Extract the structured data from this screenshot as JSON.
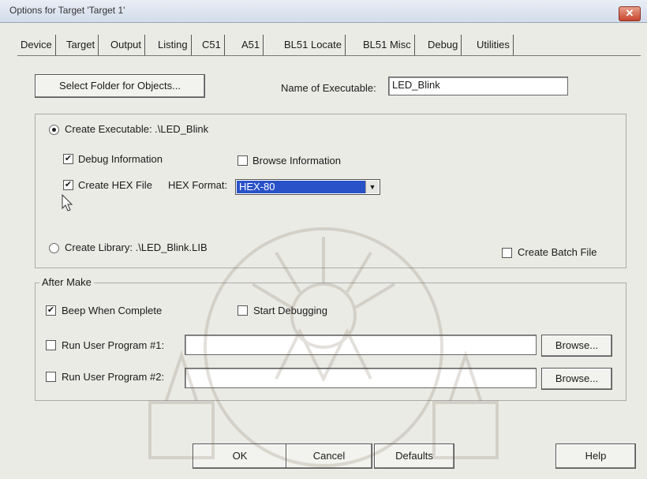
{
  "window": {
    "title": "Options for Target 'Target 1'",
    "close_symbol": "✕"
  },
  "tabs": [
    {
      "label": "Device",
      "active": false
    },
    {
      "label": "Target",
      "active": false
    },
    {
      "label": "Output",
      "active": true
    },
    {
      "label": "Listing",
      "active": false
    },
    {
      "label": "C51",
      "active": false
    },
    {
      "label": "A51",
      "active": false
    },
    {
      "label": "BL51 Locate",
      "active": false
    },
    {
      "label": "BL51 Misc",
      "active": false
    },
    {
      "label": "Debug",
      "active": false
    },
    {
      "label": "Utilities",
      "active": false
    }
  ],
  "output": {
    "select_folder_label": "Select Folder for Objects...",
    "name_exec_label": "Name of Executable:",
    "name_exec_value": "LED_Blink",
    "create_exec_label": "Create Executable: .\\LED_Blink",
    "create_exec_selected": true,
    "debug_info_label": "Debug Information",
    "debug_info_checked": true,
    "browse_info_label": "Browse Information",
    "browse_info_checked": false,
    "create_hex_label": "Create HEX File",
    "create_hex_checked": true,
    "hex_format_label": "HEX Format:",
    "hex_format_value": "HEX-80",
    "create_lib_label": "Create Library: .\\LED_Blink.LIB",
    "create_lib_selected": false,
    "create_batch_label": "Create Batch File",
    "create_batch_checked": false
  },
  "after_make": {
    "legend": "After Make",
    "beep_label": "Beep When Complete",
    "beep_checked": true,
    "start_debug_label": "Start Debugging",
    "start_debug_checked": false,
    "run1_label": "Run User Program #1:",
    "run1_checked": false,
    "run1_value": "",
    "run2_label": "Run User Program #2:",
    "run2_checked": false,
    "run2_value": "",
    "browse_label": "Browse..."
  },
  "footer": {
    "ok_label": "OK",
    "cancel_label": "Cancel",
    "defaults_label": "Defaults",
    "help_label": "Help"
  },
  "colors": {
    "accent": "#2a52c8",
    "dialog_bg": "#ebebe6"
  },
  "icons": {
    "check": "✔",
    "dropdown": "▼"
  }
}
